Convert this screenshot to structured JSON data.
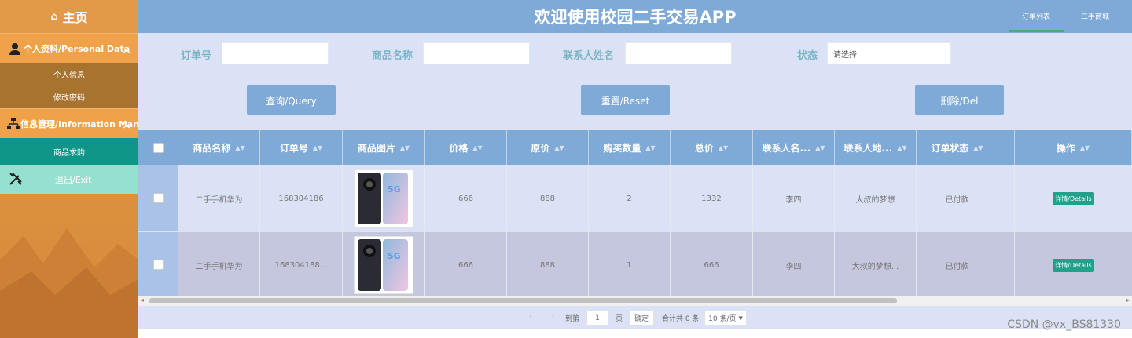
{
  "sidebar": {
    "home": "主页",
    "group1": "个人资料/Personal Data",
    "group1_items": [
      "个人信息",
      "修改密码"
    ],
    "group2": "信息管理/Information Manage",
    "group2_items": [
      "商品求购"
    ],
    "exit": "退出/Exit"
  },
  "header": {
    "title": "欢迎使用校园二手交易APP",
    "tabs": [
      "订单列表",
      "二手商城"
    ]
  },
  "search": {
    "labels": [
      "订单号",
      "商品名称",
      "联系人姓名",
      "状态"
    ],
    "status_placeholder": "请选择",
    "buttons": [
      "查询/Query",
      "重置/Reset",
      "删除/Del"
    ]
  },
  "table": {
    "columns": [
      "商品名称",
      "订单号",
      "商品图片",
      "价格",
      "原价",
      "购买数量",
      "总价",
      "联系人名...",
      "联系人地...",
      "订单状态",
      "操作"
    ],
    "rows": [
      {
        "name": "二手手机华为",
        "order": "168304186",
        "img_label": "5G",
        "price": "666",
        "orig": "888",
        "qty": "2",
        "total": "1332",
        "contact": "李四",
        "address": "大叔的梦想",
        "status": "已付款",
        "action": "详情/Details"
      },
      {
        "name": "二手手机华为",
        "order": "168304188...",
        "img_label": "5G",
        "price": "666",
        "orig": "888",
        "qty": "1",
        "total": "666",
        "contact": "李四",
        "address": "大叔的梦想...",
        "status": "已付款",
        "action": "详情/Details"
      }
    ]
  },
  "pager": {
    "goto": "到第",
    "page_value": "1",
    "page_unit": "页",
    "confirm": "确定",
    "total": "合计共 0 条",
    "page_size": "10 条/页"
  },
  "watermark": "CSDN @vx_BS81330",
  "colors": {
    "header": "#7fa9d7",
    "sidebar": "#e09a46",
    "active_item": "#0f9688",
    "detail_button": "#21a08a"
  }
}
